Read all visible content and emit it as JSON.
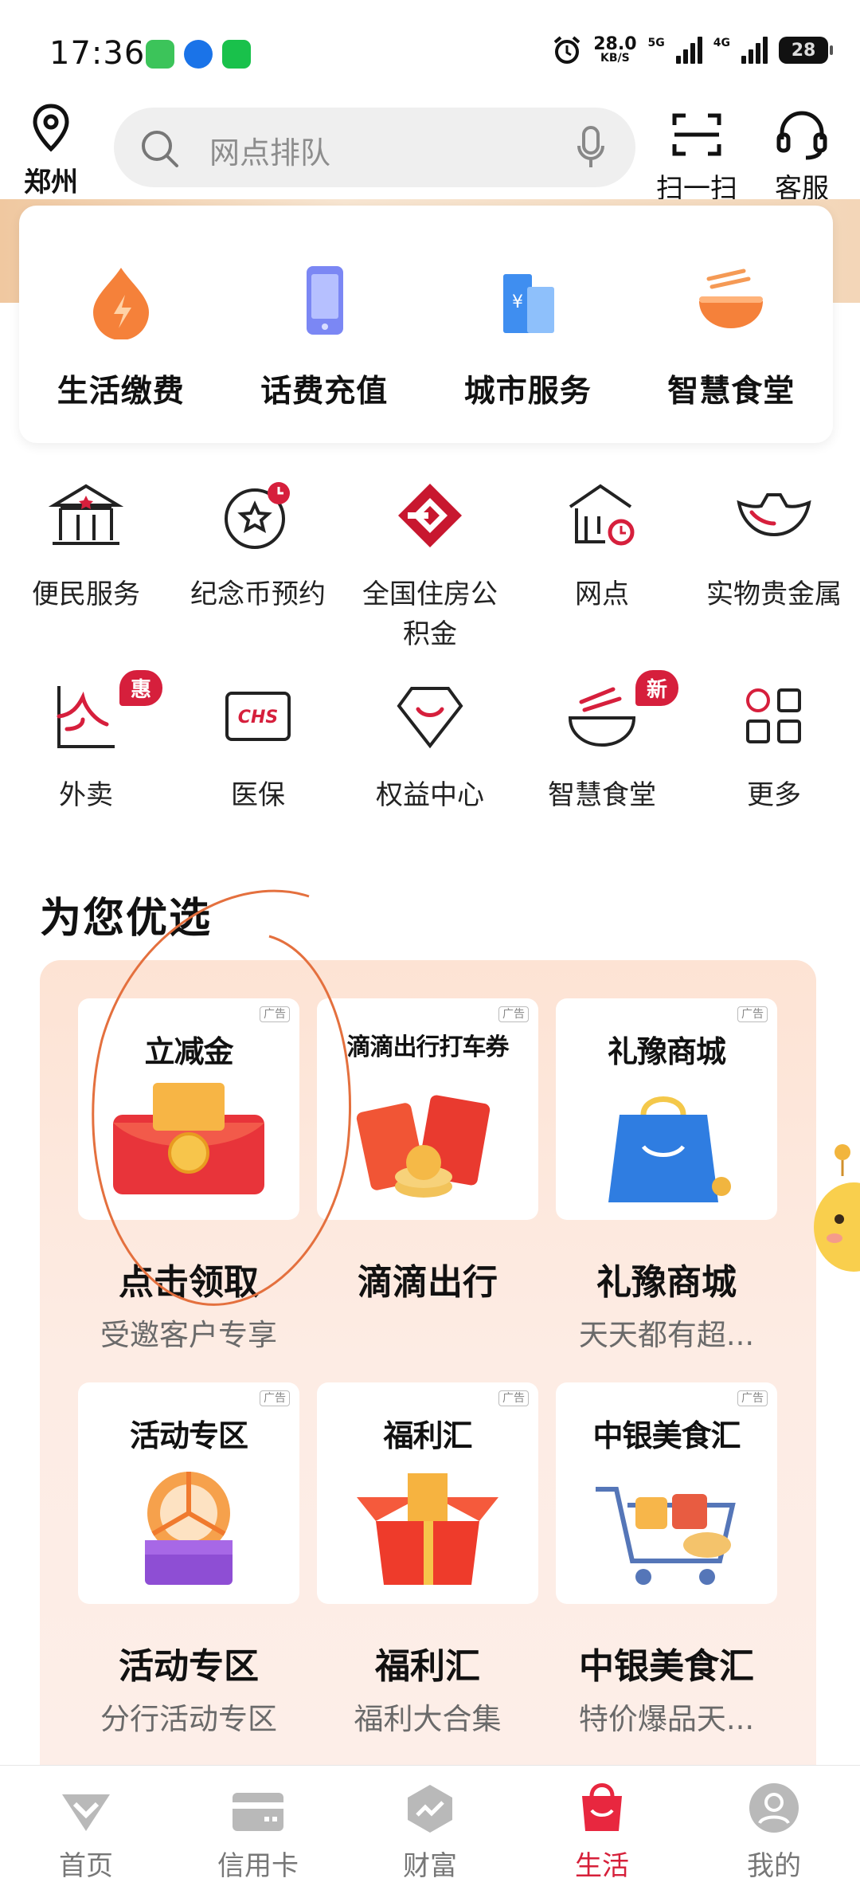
{
  "status": {
    "time": "17:36",
    "speed_value": "28.0",
    "speed_unit": "KB/S",
    "network1": "5G",
    "network2": "4G",
    "battery": "28"
  },
  "header": {
    "location": "郑州",
    "search_placeholder": "网点排队",
    "scan_label": "扫一扫",
    "service_label": "客服"
  },
  "top_services": [
    {
      "label": "生活缴费",
      "icon": "flame-drop-icon"
    },
    {
      "label": "话费充值",
      "icon": "phone-icon"
    },
    {
      "label": "城市服务",
      "icon": "city-building-icon"
    },
    {
      "label": "智慧食堂",
      "icon": "noodle-bowl-icon"
    }
  ],
  "grid_row1": [
    {
      "label": "便民服务",
      "icon": "temple-icon"
    },
    {
      "label": "纪念币预约",
      "icon": "coin-star-icon"
    },
    {
      "label": "全国住房公积金",
      "icon": "housing-fund-logo-icon"
    },
    {
      "label": "网点",
      "icon": "branch-clock-icon"
    },
    {
      "label": "实物贵金属",
      "icon": "gold-ingot-icon"
    }
  ],
  "grid_row2": [
    {
      "label": "外卖",
      "icon": "takeout-icon",
      "badge": "惠"
    },
    {
      "label": "医保",
      "icon": "chs-card-icon"
    },
    {
      "label": "权益中心",
      "icon": "gem-smile-icon"
    },
    {
      "label": "智慧食堂",
      "icon": "noodle-bowl-line-icon",
      "badge": "新"
    },
    {
      "label": "更多",
      "icon": "grid-more-icon"
    }
  ],
  "section_title": "为您优选",
  "ad_label": "广告",
  "tiles": [
    {
      "banner": "立减金",
      "name": "点击领取",
      "desc": "受邀客户专享"
    },
    {
      "banner": "滴滴出行打车券",
      "name": "滴滴出行",
      "desc": ""
    },
    {
      "banner": "礼豫商城",
      "name": "礼豫商城",
      "desc": "天天都有超..."
    },
    {
      "banner": "活动专区",
      "name": "活动专区",
      "desc": "分行活动专区"
    },
    {
      "banner": "福利汇",
      "name": "福利汇",
      "desc": "福利大合集"
    },
    {
      "banner": "中银美食汇",
      "name": "中银美食汇",
      "desc": "特价爆品天..."
    }
  ],
  "tabs": [
    {
      "label": "首页"
    },
    {
      "label": "信用卡"
    },
    {
      "label": "财富"
    },
    {
      "label": "生活"
    },
    {
      "label": "我的"
    }
  ],
  "colors": {
    "accent": "#d6203a",
    "promo_bg": "#fde3d4"
  }
}
